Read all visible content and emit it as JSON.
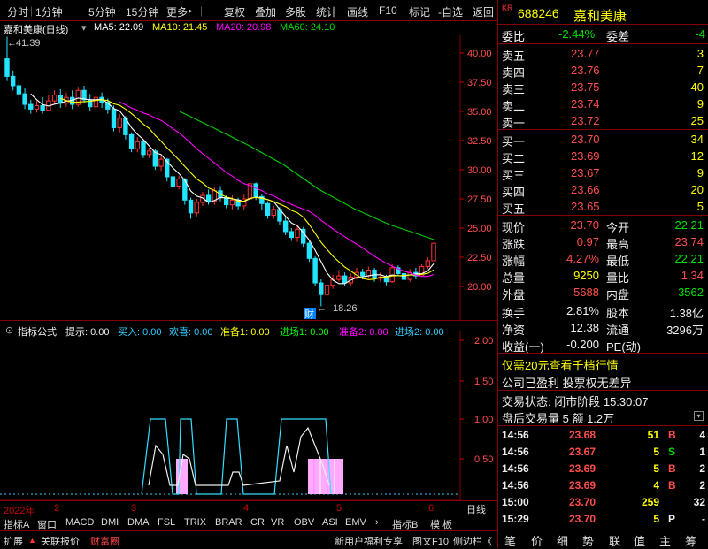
{
  "toolbar": {
    "items": [
      "分时",
      "1分钟",
      "5分钟",
      "15分钟",
      "更多",
      "复权",
      "叠加",
      "多股",
      "统计",
      "画线",
      "F10",
      "标记",
      "-自选",
      "返回"
    ],
    "more_arrow": "▸"
  },
  "chart_title": {
    "name": "嘉和美康(日线)",
    "expand": "▾",
    "ma5": "MA5: 22.09",
    "ma10": "MA10: 21.45",
    "ma20": "MA20: 20.98",
    "ma60": "MA60: 24.10"
  },
  "colors": {
    "up": "#ff3333",
    "down": "#22e4ff",
    "ma5": "#ffffff",
    "ma10": "#ffff00",
    "ma20": "#ff00ff",
    "ma60": "#00d000"
  },
  "price_axis": [
    "40.00",
    "37.50",
    "35.00",
    "32.50",
    "30.00",
    "27.50",
    "25.00",
    "22.50",
    "20.00"
  ],
  "annotations": {
    "high": "41.39",
    "low": "18.26",
    "cai": "财"
  },
  "indicator": {
    "title": "指标公式",
    "tip": "提示: 0.00",
    "buy": "买入: 0.00",
    "joy": "欢喜: 0.00",
    "prep1": "准备1: 0.00",
    "enter1": "进场1: 0.00",
    "prep2": "准备2: 0.00",
    "enter2": "进场2: 0.00",
    "axis": [
      "2.00",
      "1.50",
      "1.00",
      "0.50"
    ]
  },
  "dates": {
    "d1": "2022年",
    "d2": "2",
    "d3": "3",
    "d4": "4",
    "d5": "5",
    "d6": "6",
    "period": "日线"
  },
  "tabs": [
    "指标A",
    "窗口",
    "MACD",
    "DMI",
    "DMA",
    "FSL",
    "TRIX",
    "BRAR",
    "CR",
    "VR",
    "OBV",
    "ASI",
    "EMV",
    "指标B",
    "模 板"
  ],
  "tabs_arrow": "›",
  "bottom": {
    "expand": "扩展",
    "link": "关联报价",
    "fortune": "财富圈",
    "news": "新用户福利专享",
    "f10": "图文F10",
    "sidebar": "侧边栏《"
  },
  "quote": {
    "kr": "KR",
    "code": "688246",
    "name": "嘉和美康",
    "wb_label": "委比",
    "wb": "-2.44%",
    "wc_label": "委差",
    "wc": "-4",
    "asks": [
      {
        "l": "卖五",
        "p": "23.77",
        "v": "3"
      },
      {
        "l": "卖四",
        "p": "23.76",
        "v": "7"
      },
      {
        "l": "卖三",
        "p": "23.75",
        "v": "40"
      },
      {
        "l": "卖二",
        "p": "23.74",
        "v": "9"
      },
      {
        "l": "卖一",
        "p": "23.72",
        "v": "25"
      }
    ],
    "bids": [
      {
        "l": "买一",
        "p": "23.70",
        "v": "34"
      },
      {
        "l": "买二",
        "p": "23.69",
        "v": "12"
      },
      {
        "l": "买三",
        "p": "23.67",
        "v": "9"
      },
      {
        "l": "买四",
        "p": "23.66",
        "v": "20"
      },
      {
        "l": "买五",
        "p": "23.65",
        "v": "5"
      }
    ],
    "stats": [
      {
        "a": "现价",
        "av": "23.70",
        "b": "今开",
        "bv": "22.21"
      },
      {
        "a": "涨跌",
        "av": "0.97",
        "b": "最高",
        "bv": "23.74"
      },
      {
        "a": "涨幅",
        "av": "4.27%",
        "b": "最低",
        "bv": "22.21"
      },
      {
        "a": "总量",
        "av": "9250",
        "b": "量比",
        "bv": "1.34"
      },
      {
        "a": "外盘",
        "av": "5688",
        "b": "内盘",
        "bv": "3562"
      }
    ],
    "stats2": [
      {
        "a": "换手",
        "av": "2.81%",
        "b": "股本",
        "bv": "1.38亿"
      },
      {
        "a": "净资",
        "av": "12.38",
        "b": "流通",
        "bv": "3296万"
      },
      {
        "a": "收益(一)",
        "av": "-0.200",
        "b": "PE(动)",
        "bv": ""
      }
    ],
    "promo": "仅需20元查看千档行情",
    "profit": "公司已盈利 投票权无差异",
    "status": "交易状态: 闭市阶段 15:30:07",
    "after": "盘后交易量 5 额 1.2万",
    "trades": [
      {
        "t": "14:56",
        "p": "23.68",
        "v": "51",
        "d": "B",
        "n": "4"
      },
      {
        "t": "14:56",
        "p": "23.67",
        "v": "5",
        "d": "S",
        "n": "1"
      },
      {
        "t": "14:56",
        "p": "23.69",
        "v": "5",
        "d": "B",
        "n": "2"
      },
      {
        "t": "14:56",
        "p": "23.69",
        "v": "4",
        "d": "B",
        "n": "2"
      },
      {
        "t": "15:00",
        "p": "23.70",
        "v": "259",
        "d": "",
        "n": "32"
      },
      {
        "t": "15:29",
        "p": "23.70",
        "v": "5",
        "d": "P",
        "n": "-"
      }
    ],
    "tabs": [
      "笔",
      "价",
      "细",
      "势",
      "联",
      "值",
      "主",
      "筹"
    ]
  }
}
